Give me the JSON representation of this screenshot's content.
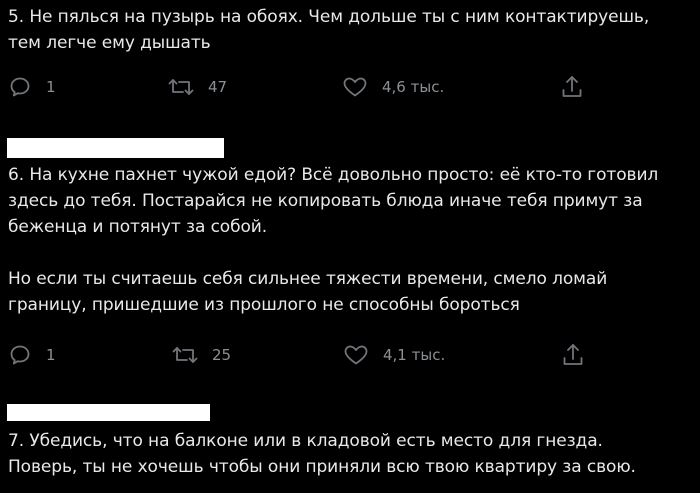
{
  "tweets": [
    {
      "text": "5. Не пялься на пузырь на обоях. Чем дольше ты с ним контактируешь,\nтем легче ему дышать",
      "replies": "1",
      "retweets": "47",
      "likes": "4,6 тыс."
    },
    {
      "text": "6. На кухне пахнет чужой едой? Всё довольно просто: её кто-то готовил\nздесь до тебя. Постарайся не копировать блюда иначе тебя примут за\nбеженца и потянут за собой.\n\nНо если ты считаешь себя сильнее тяжести времени, смело ломай\nграницу, пришедшие из прошлого не способны бороться",
      "replies": "1",
      "retweets": "25",
      "likes": "4,1 тыс."
    },
    {
      "text": "7. Убедись, что на балконе или в кладовой есть место для гнезда.\nПоверь, ты не хочешь чтобы они приняли всю твою квартиру за свою."
    }
  ],
  "icons": {
    "reply": "reply-icon",
    "retweet": "retweet-icon",
    "like": "heart-icon",
    "share": "share-icon"
  },
  "colors": {
    "background": "#000000",
    "text": "#e7e9ea",
    "icon": "#71767b",
    "redaction": "#ffffff"
  }
}
